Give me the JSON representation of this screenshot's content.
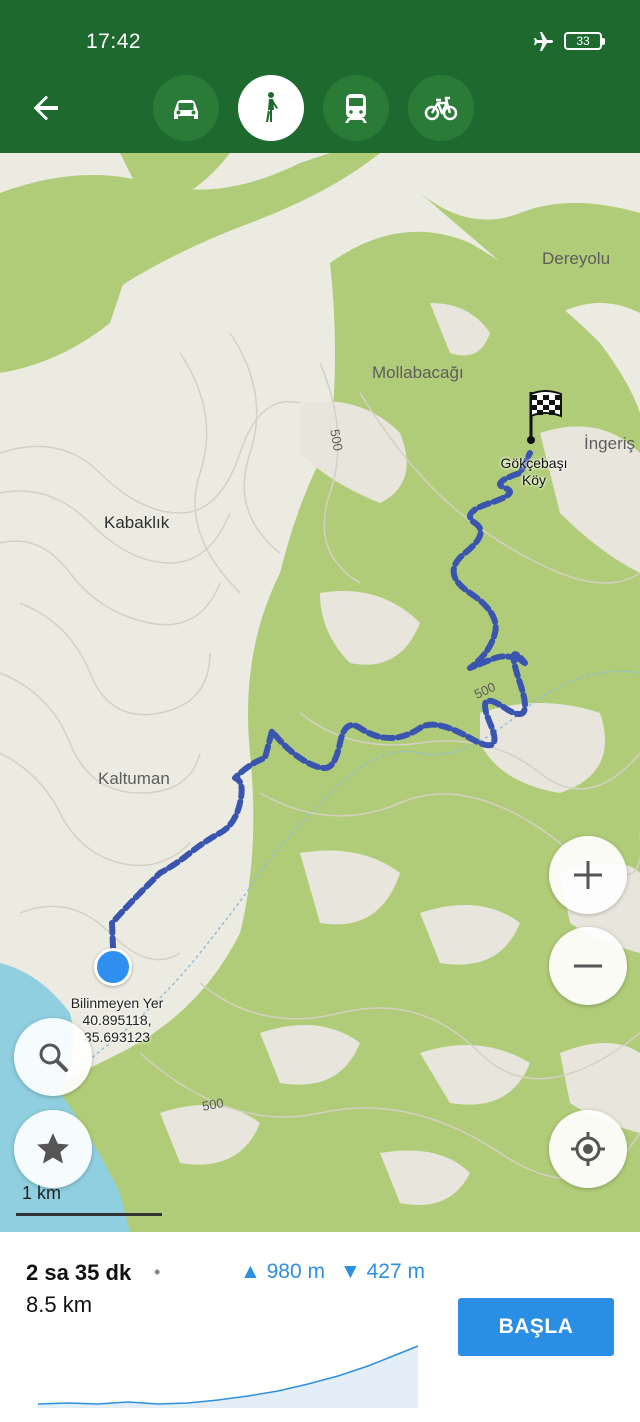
{
  "status_bar": {
    "time": "17:42",
    "battery": "33",
    "plane_icon": "airplane-icon"
  },
  "toolbar": {
    "back_icon": "arrow-left-icon",
    "modes": [
      {
        "name": "car",
        "icon": "car-icon",
        "active": false
      },
      {
        "name": "walk",
        "icon": "pedestrian-icon",
        "active": true
      },
      {
        "name": "transit",
        "icon": "train-icon",
        "active": false
      },
      {
        "name": "bike",
        "icon": "bicycle-icon",
        "active": false
      }
    ]
  },
  "map": {
    "places": [
      "Dereyolu",
      "Mollabacağı",
      "İngeriş",
      "Kabaklık",
      "Kaltuman"
    ],
    "contour_labels": [
      "500",
      "500",
      "500"
    ],
    "destination": {
      "line1": "Gökçebaşı",
      "line2": "Köy"
    },
    "current_location": {
      "name": "Bilinmeyen Yer",
      "lat": "40.895118,",
      "lon": "35.693123"
    },
    "scale": "1 km",
    "buttons": {
      "zoom_in": "plus-icon",
      "zoom_out": "minus-icon",
      "search": "search-icon",
      "favorites": "star-icon",
      "locate": "crosshair-icon"
    }
  },
  "route_summary": {
    "duration": "2 sa 35 dk",
    "separator": "•",
    "distance": "8.5 km",
    "ascent": "▲ 980 m",
    "descent": "▼ 427 m",
    "start_label": "BAŞLA"
  },
  "colors": {
    "toolbar": "#1e6a2e",
    "accent": "#2a8fe4",
    "forest": "#a9c76c",
    "route": "#3a55b0"
  }
}
